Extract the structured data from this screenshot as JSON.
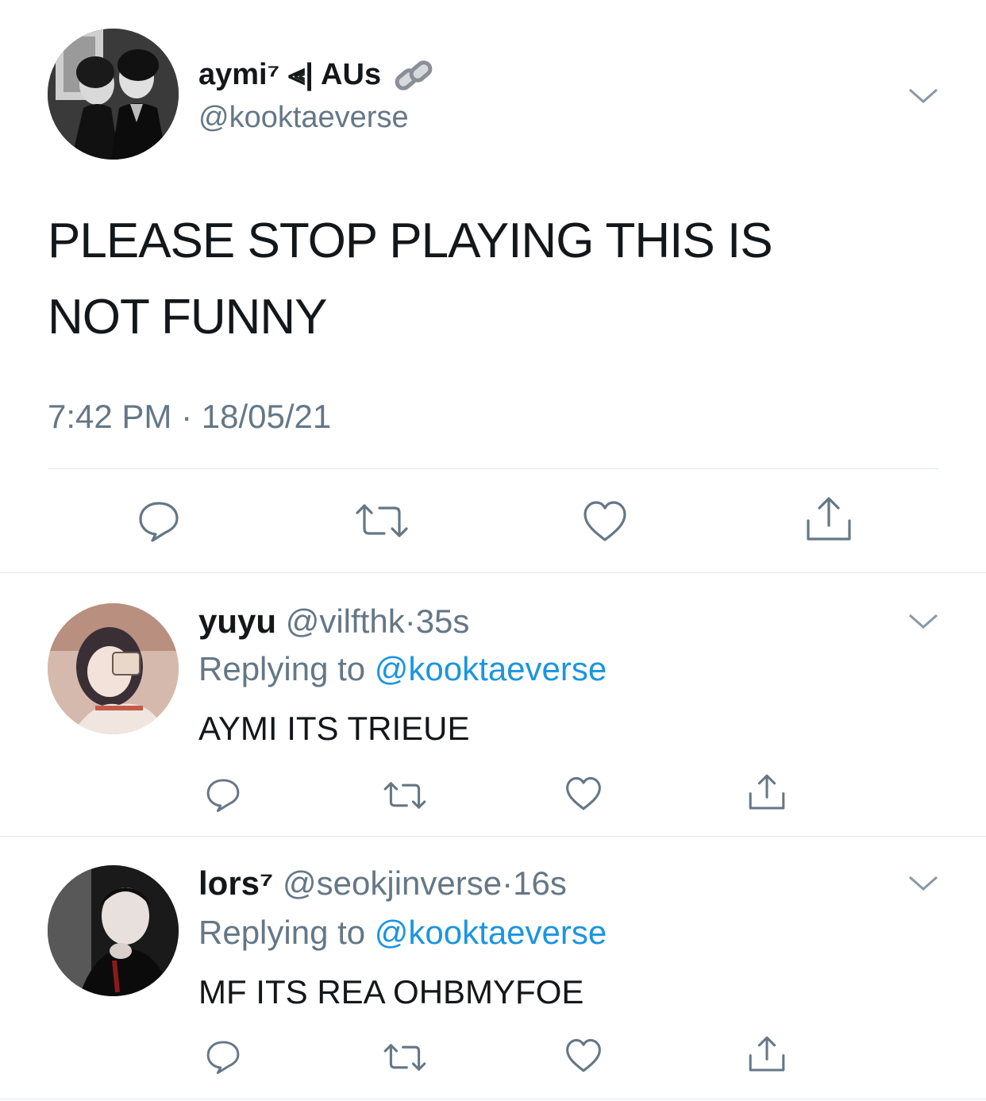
{
  "main_tweet": {
    "display_name": "aymi⁷ ⫷| AUs",
    "handle": "@kooktaeverse",
    "text_line1": "PLEASE STOP PLAYING THIS IS",
    "text_line2": "NOT FUNNY",
    "time": "7:42 PM",
    "separator": "·",
    "date": "18/05/21",
    "icons": [
      "reply-icon",
      "retweet-icon",
      "like-icon",
      "share-icon"
    ]
  },
  "replies": [
    {
      "display_name": "yuyu",
      "handle": "@vilfthk",
      "separator": "·",
      "age": "35s",
      "replying_prefix": "Replying to",
      "replying_to": "@kooktaeverse",
      "text": "AYMI ITS TRIEUE"
    },
    {
      "display_name": "lors⁷",
      "handle": "@seokjinverse",
      "separator": "·",
      "age": "16s",
      "replying_prefix": "Replying to",
      "replying_to": "@kooktaeverse",
      "text": "MF ITS REA OHBMYFOE"
    }
  ],
  "colors": {
    "text": "#14171a",
    "muted": "#657786",
    "link": "#1b95e0",
    "divider": "#e1e8ed"
  }
}
